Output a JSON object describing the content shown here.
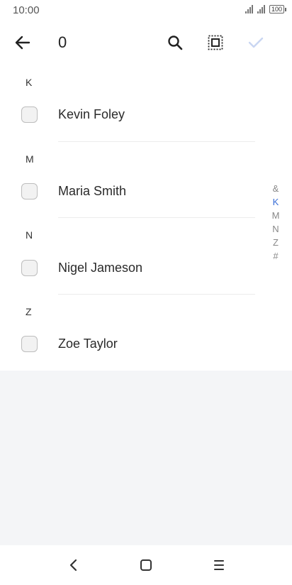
{
  "status_bar": {
    "time": "10:00",
    "battery": "100"
  },
  "app_bar": {
    "selected_count": "0"
  },
  "icons": {
    "back": "arrow-left-icon",
    "search": "search-icon",
    "select_all": "select-all-icon",
    "confirm": "check-icon",
    "nav_back": "chevron-left-icon",
    "nav_home": "square-icon",
    "nav_menu": "menu-icon"
  },
  "sections": [
    {
      "letter": "K",
      "contacts": [
        {
          "name": "Kevin Foley",
          "checked": false
        }
      ]
    },
    {
      "letter": "M",
      "contacts": [
        {
          "name": "Maria Smith",
          "checked": false
        }
      ]
    },
    {
      "letter": "N",
      "contacts": [
        {
          "name": "Nigel Jameson",
          "checked": false
        }
      ]
    },
    {
      "letter": "Z",
      "contacts": [
        {
          "name": "Zoe Taylor",
          "checked": false
        }
      ]
    }
  ],
  "index_bar": [
    "&",
    "K",
    "M",
    "N",
    "Z",
    "#"
  ],
  "index_active": "K",
  "colors": {
    "accent": "#3b6fd8",
    "confirm_disabled": "#c9d6f2"
  }
}
